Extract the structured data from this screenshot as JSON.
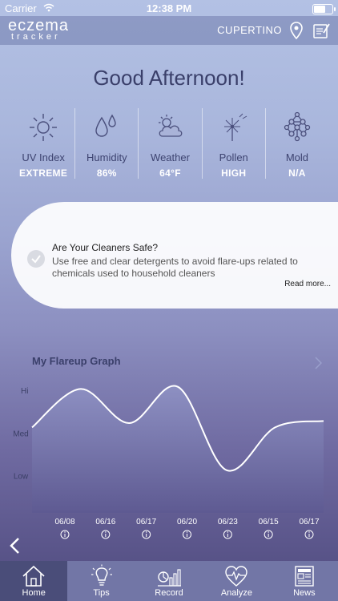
{
  "status_bar": {
    "carrier": "Carrier",
    "time": "12:38 PM"
  },
  "header": {
    "logo_line1": "eczema",
    "logo_line2": "tracker",
    "location": "CUPERTINO",
    "icons": [
      "location-pin-icon",
      "notepad-icon"
    ]
  },
  "greeting": "Good Afternoon!",
  "conditions": [
    {
      "label": "UV Index",
      "value": "EXTREME",
      "icon": "sun-icon"
    },
    {
      "label": "Humidity",
      "value": "86%",
      "icon": "water-drops-icon"
    },
    {
      "label": "Weather",
      "value": "64°F",
      "icon": "partly-cloudy-icon"
    },
    {
      "label": "Pollen",
      "value": "HIGH",
      "icon": "dandelion-icon"
    },
    {
      "label": "Mold",
      "value": "N/A",
      "icon": "mold-spore-icon"
    }
  ],
  "tip": {
    "title": "Are Your Cleaners Safe?",
    "body": "Use free and clear detergents to avoid flare-ups related to chemicals used to household cleaners",
    "link": "Read more..."
  },
  "graph": {
    "title": "My Flareup Graph"
  },
  "chart_data": {
    "type": "area",
    "y_levels": [
      "Hi",
      "Med",
      "Low"
    ],
    "ylim": [
      0,
      3
    ],
    "x": [
      "06/08",
      "06/16",
      "06/17",
      "06/20",
      "06/23",
      "06/15",
      "06/17"
    ],
    "y": [
      2.0,
      2.9,
      2.1,
      2.95,
      1.0,
      2.0,
      2.15
    ],
    "grid": false
  },
  "tabs": [
    {
      "label": "Home",
      "icon": "home-icon",
      "active": true
    },
    {
      "label": "Tips",
      "icon": "lightbulb-icon",
      "active": false
    },
    {
      "label": "Record",
      "icon": "record-chart-icon",
      "active": false
    },
    {
      "label": "Analyze",
      "icon": "heart-pulse-icon",
      "active": false
    },
    {
      "label": "News",
      "icon": "newspaper-icon",
      "active": false
    }
  ]
}
